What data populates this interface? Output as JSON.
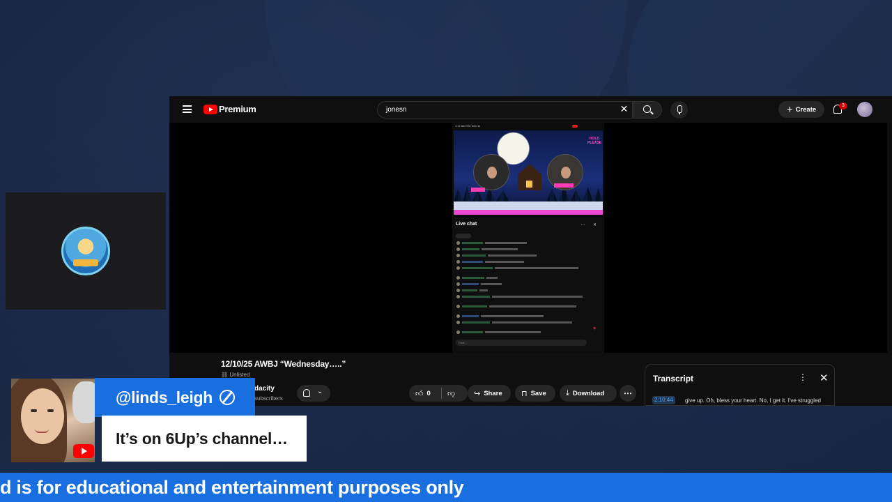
{
  "youtube": {
    "brand": "Premium",
    "search": {
      "value": "jonesn"
    },
    "create_label": "Create",
    "notification_count": "3",
    "video": {
      "status_bar_time": "1:17 AM   Thu Dec 11",
      "hold_sign": "HOLD PLEASE",
      "chat_title": "Live chat",
      "chat_input_placeholder": "Chat..."
    },
    "title": "12/10/25 AWBJ “Wednesday…..”",
    "visibility": "Unlisted",
    "channel_name": "dacity",
    "channel_subs": "subscribers",
    "like_count": "0",
    "share_label": "Share",
    "save_label": "Save",
    "download_label": "Download",
    "transcript": {
      "title": "Transcript",
      "timestamp": "2:10:44",
      "text": "give up. Oh, bless your heart. No, I get it. I've struggled"
    }
  },
  "overlay": {
    "handle": "@linds_leigh",
    "message": "It’s on 6Up’s channel…",
    "ticker": "d is for educational and entertainment purposes only"
  },
  "colors": {
    "background": "#16233f",
    "accent_blue": "#1a6fe0",
    "youtube_red": "#ff0000",
    "youtube_dark": "#0f0f0f"
  }
}
